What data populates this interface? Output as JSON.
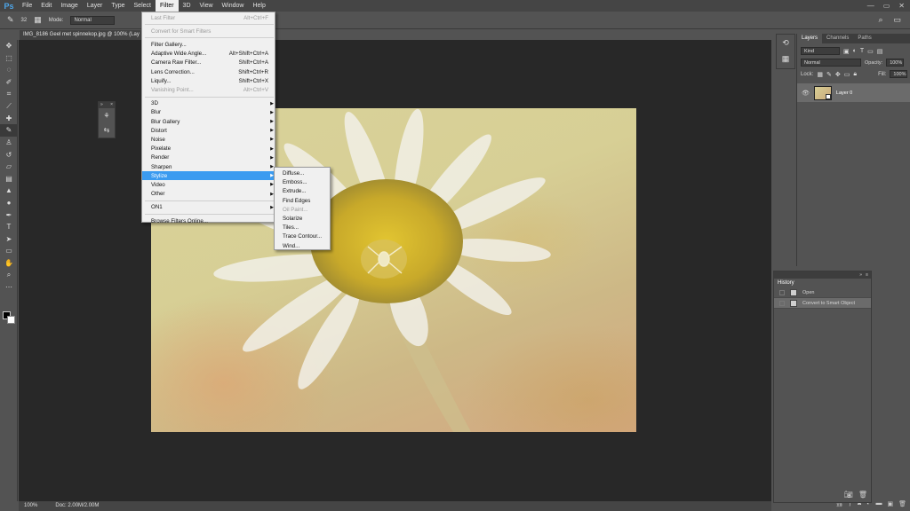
{
  "app": {
    "logo": "Ps"
  },
  "menubar": {
    "items": [
      "File",
      "Edit",
      "Image",
      "Layer",
      "Type",
      "Select",
      "Filter",
      "3D",
      "View",
      "Window",
      "Help"
    ],
    "active": "Filter",
    "window_controls": [
      "—",
      "▭",
      "✕"
    ]
  },
  "options_bar": {
    "mode_label": "Mode:",
    "mode_value": "Normal",
    "brush_size": "32"
  },
  "document": {
    "tab_title": "IMG_8186 Geel met spinnekop.jpg @ 100% (Lay"
  },
  "filter_menu": {
    "items": [
      {
        "label": "Last Filter",
        "shortcut": "Alt+Ctrl+F",
        "disabled": true
      },
      {
        "sep": true
      },
      {
        "label": "Convert for Smart Filters",
        "disabled": true
      },
      {
        "sep": true
      },
      {
        "label": "Filter Gallery..."
      },
      {
        "label": "Adaptive Wide Angle...",
        "shortcut": "Alt+Shift+Ctrl+A"
      },
      {
        "label": "Camera Raw Filter...",
        "shortcut": "Shift+Ctrl+A"
      },
      {
        "label": "Lens Correction...",
        "shortcut": "Shift+Ctrl+R"
      },
      {
        "label": "Liquify...",
        "shortcut": "Shift+Ctrl+X"
      },
      {
        "label": "Vanishing Point...",
        "shortcut": "Alt+Ctrl+V",
        "disabled": true
      },
      {
        "sep": true
      },
      {
        "label": "3D",
        "submenu": true
      },
      {
        "label": "Blur",
        "submenu": true
      },
      {
        "label": "Blur Gallery",
        "submenu": true
      },
      {
        "label": "Distort",
        "submenu": true
      },
      {
        "label": "Noise",
        "submenu": true
      },
      {
        "label": "Pixelate",
        "submenu": true
      },
      {
        "label": "Render",
        "submenu": true
      },
      {
        "label": "Sharpen",
        "submenu": true
      },
      {
        "label": "Stylize",
        "submenu": true,
        "highlighted": true
      },
      {
        "label": "Video",
        "submenu": true
      },
      {
        "label": "Other",
        "submenu": true
      },
      {
        "sep": true
      },
      {
        "label": "ON1",
        "submenu": true
      },
      {
        "sep": true
      },
      {
        "label": "Browse Filters Online..."
      }
    ]
  },
  "stylize_submenu": {
    "items": [
      {
        "label": "Diffuse..."
      },
      {
        "label": "Emboss..."
      },
      {
        "label": "Extrude..."
      },
      {
        "label": "Find Edges"
      },
      {
        "label": "Oil Paint...",
        "disabled": true
      },
      {
        "label": "Solarize"
      },
      {
        "label": "Tiles..."
      },
      {
        "label": "Trace Contour..."
      },
      {
        "label": "Wind..."
      }
    ]
  },
  "layers_panel": {
    "tabs": [
      "Layers",
      "Channels",
      "Paths"
    ],
    "active_tab": "Layers",
    "kind_filter": "Kind",
    "blend_mode": "Normal",
    "opacity_label": "Opacity:",
    "opacity_value": "100%",
    "lock_label": "Lock:",
    "fill_label": "Fill:",
    "fill_value": "100%",
    "layers": [
      {
        "name": "Layer 0",
        "visible": true
      }
    ]
  },
  "history_panel": {
    "title": "History",
    "items": [
      {
        "label": "Open",
        "active": false
      },
      {
        "label": "Convert to Smart Object",
        "active": true
      }
    ]
  },
  "statusbar": {
    "zoom": "100%",
    "doc_info": "Doc: 2.00M/2.00M"
  },
  "colors": {
    "menu_highlight": "#3b9bf0",
    "foreground": "#000000",
    "background": "#ffffff"
  }
}
